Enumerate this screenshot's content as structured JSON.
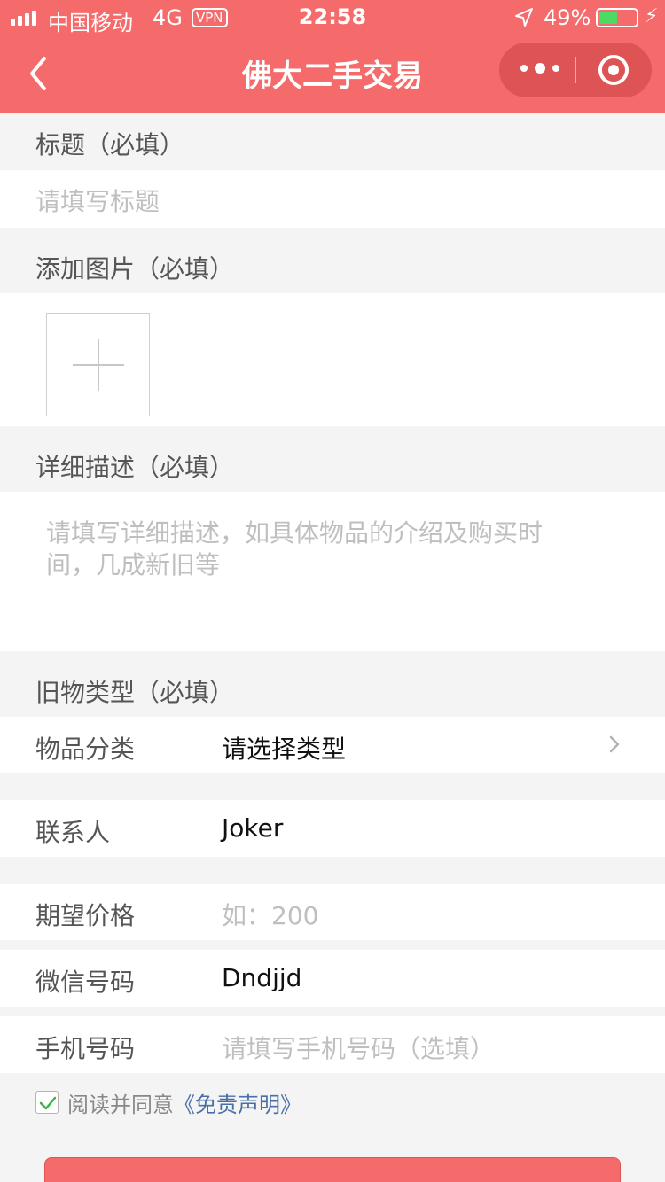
{
  "status_bar": {
    "carrier": "中国移动",
    "network": "4G",
    "vpn": "VPN",
    "time": "22:58",
    "battery_pct": "49%",
    "battery_level": 0.49
  },
  "navbar": {
    "title": "佛大二手交易"
  },
  "form": {
    "title_section": {
      "label": "标题（必填）",
      "placeholder": "请填写标题"
    },
    "images_section": {
      "label": "添加图片（必填）"
    },
    "description_section": {
      "label": "详细描述（必填）",
      "placeholder": "请填写详细描述，如具体物品的介绍及购买时间，几成新旧等"
    },
    "type_section": {
      "label": "旧物类型（必填）"
    },
    "category": {
      "label": "物品分类",
      "value": "请选择类型"
    },
    "contact": {
      "label": "联系人",
      "value": "Joker"
    },
    "price": {
      "label": "期望价格",
      "placeholder": "如：200"
    },
    "wechat": {
      "label": "微信号码",
      "value": "Dndjjd"
    },
    "phone": {
      "label": "手机号码",
      "placeholder": "请填写手机号码（选填）"
    },
    "agreement": {
      "text": "阅读并同意",
      "link": "《免责声明》",
      "checked": true
    }
  },
  "colors": {
    "accent": "#f56b6b",
    "link": "#4a6fa5",
    "placeholder": "#bfbfbf"
  }
}
